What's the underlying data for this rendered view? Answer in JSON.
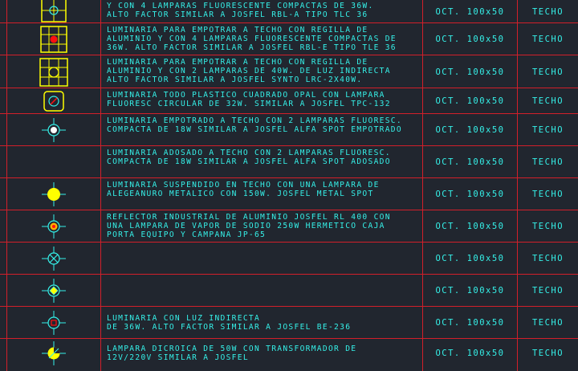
{
  "colors": {
    "background": "#21262f",
    "grid": "#d21f2a",
    "text": "#35f0e8",
    "symbol_yellow": "#ffff00",
    "symbol_cyan": "#35f0e8",
    "symbol_red": "#ff1010"
  },
  "rows": [
    {
      "symbol": "square-grid-4-circle-icon",
      "description": "Y CON 4 LAMPARAS FLUORESCENTE COMPACTAS DE 36W.\nALTO FACTOR SIMILAR A JOSFEL RBL-A TIPO TLC 36",
      "size": "OCT. 100x50",
      "mount": "TECHO"
    },
    {
      "symbol": "square-grid-red-dot-icon",
      "description": "LUMINARIA PARA EMPOTRAR A TECHO CON REGILLA DE\nALUMINIO Y CON 4 LAMPARAS FLUORESCENTE COMPACTAS DE\n36W. ALTO FACTOR SIMILAR A JOSFEL RBL-E TIPO TLE 36",
      "size": "OCT. 100x50",
      "mount": "TECHO"
    },
    {
      "symbol": "square-grid-double-lamp-icon",
      "description": "LUMINARIA PARA EMPOTRAR A TECHO CON REGILLA DE\nALUMINIO Y CON 2 LAMPARAS DE 40W. DE LUZ INDIRECTA\nALTO FACTOR SIMILAR A JOSFEL SYNTO LRC-2x40W.",
      "size": "OCT. 100x50",
      "mount": "TECHO"
    },
    {
      "symbol": "rounded-square-circle-icon",
      "description": "LUMINARIA TODO PLASTICO CUADRADO OPAL CON LAMPARA\nFLUORESC CIRCULAR DE 32W. SIMILAR A JOSFEL TPC-132",
      "size": "OCT. 100x50",
      "mount": "TECHO"
    },
    {
      "symbol": "crosshair-white-dot-icon",
      "description": "LUMINARIA EMPOTRADO A TECHO CON 2 LAMPARAS FLUORESC.\nCOMPACTA DE 18W SIMILAR A JOSFEL ALFA SPOT EMPOTRADO",
      "size": "OCT. 100x50",
      "mount": "TECHO"
    },
    {
      "symbol": "",
      "description": "LUMINARIA ADOSADO A TECHO CON 2 LAMPARAS FLUORESC.\nCOMPACTA DE 18W SIMILAR A JOSFEL ALFA SPOT ADOSADO",
      "size": "OCT. 100x50",
      "mount": "TECHO"
    },
    {
      "symbol": "crosshair-yellow-disc-icon",
      "description": "LUMINARIA SUSPENDIDO EN TECHO CON UNA LAMPARA DE\nALEGEANURO METALICO CON 150W. JOSFEL METAL SPOT",
      "size": "OCT. 100x50",
      "mount": "TECHO"
    },
    {
      "symbol": "crosshair-red-yellow-dot-icon",
      "description": "REFLECTOR INDUSTRIAL DE ALUMINIO JOSFEL RL 400 CON\nUNA LAMPARA DE VAPOR DE SODIO 250W HERMETICO CAJA\nPORTA EQUIPO Y CAMPANA JP-65",
      "size": "OCT. 100x50",
      "mount": "TECHO"
    },
    {
      "symbol": "crosshair-x-circle-icon",
      "description": "",
      "size": "OCT. 100x50",
      "mount": "TECHO"
    },
    {
      "symbol": "crosshair-diamond-icon",
      "description": "",
      "size": "OCT. 100x50",
      "mount": "TECHO"
    },
    {
      "symbol": "crosshair-square-icon",
      "description": "LUMINARIA CON LUZ INDIRECTA\nDE 36W. ALTO FACTOR SIMILAR A JOSFEL BE-236",
      "size": "OCT. 100x50",
      "mount": "TECHO"
    },
    {
      "symbol": "crosshair-dichroic-icon",
      "description": "LAMPARA DICROICA DE 50W CON TRANSFORMADOR DE\n12V/220V SIMILAR A JOSFEL",
      "size": "OCT. 100x50",
      "mount": "TECHO"
    }
  ]
}
